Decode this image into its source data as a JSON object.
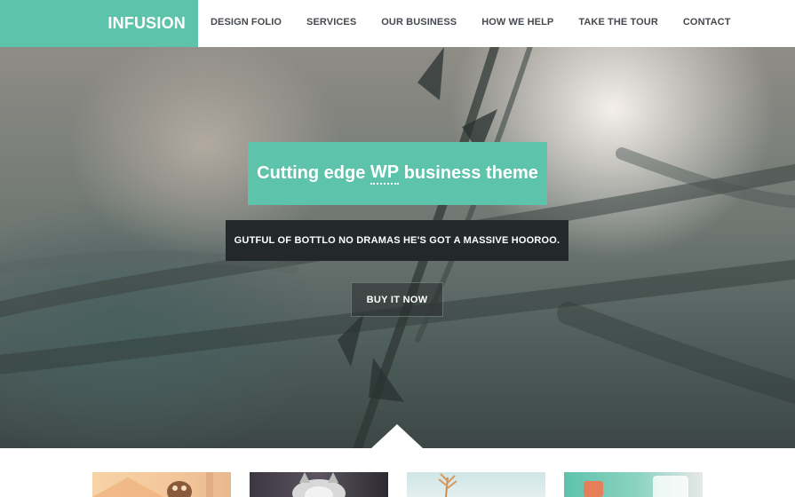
{
  "brand": {
    "logo_text": "INFUSION",
    "accent_color": "#5ec3ab"
  },
  "nav": {
    "items": [
      {
        "label": "DESIGN FOLIO"
      },
      {
        "label": "SERVICES"
      },
      {
        "label": "OUR BUSINESS"
      },
      {
        "label": "HOW WE HELP"
      },
      {
        "label": "TAKE THE TOUR"
      },
      {
        "label": "CONTACT"
      }
    ]
  },
  "hero": {
    "title_before": "Cutting edge ",
    "title_abbr": "WP",
    "title_after": " business theme",
    "subtitle": "GUTFUL OF BOTTLO NO DRAMAS HE'S GOT A MASSIVE HOOROO.",
    "cta_label": "BUY IT NOW"
  },
  "portfolio": {
    "thumbnails": [
      {
        "subject": "orange-illustration-owl"
      },
      {
        "subject": "grey-cat-photo"
      },
      {
        "subject": "plant-on-sky"
      },
      {
        "subject": "mobile-app-mockup"
      }
    ]
  }
}
